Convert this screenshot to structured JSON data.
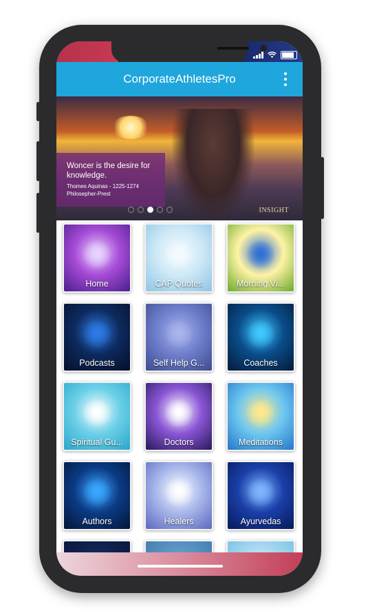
{
  "app": {
    "title": "CorporateAthletesPro"
  },
  "banner": {
    "quote": "Woncer is the desire for knowledge.",
    "author": "Thomes Aquinas - 1225-1274",
    "role": "Philosepher-Prest",
    "logo_text": "INSIGHT",
    "slides_count": 5,
    "active_slide": 2
  },
  "tiles": [
    {
      "label": "Home",
      "icon": "mandala-icon",
      "colors": [
        "#e8d4ff",
        "#a64bd6",
        "#4a1f8c"
      ]
    },
    {
      "label": "CAP Quotes",
      "icon": "flask-quote-icon",
      "colors": [
        "#f4fbff",
        "#cfe9f7",
        "#8ec5e6"
      ]
    },
    {
      "label": "Morning Vi...",
      "icon": "sunrise-field-icon",
      "colors": [
        "#2f6fd6",
        "#fff3a6",
        "#6cab2c"
      ]
    },
    {
      "label": "Podcasts",
      "icon": "microphone-icon",
      "colors": [
        "#2c7be6",
        "#0d2a5e",
        "#050f2a"
      ]
    },
    {
      "label": "Self Help G...",
      "icon": "ladder-lightbulb-icon",
      "colors": [
        "#a8b4ec",
        "#6f7fcc",
        "#3f4b8f"
      ]
    },
    {
      "label": "Coaches",
      "icon": "lightbulb-brain-icon",
      "colors": [
        "#3fc8ff",
        "#0a4d8a",
        "#041a3a"
      ]
    },
    {
      "label": "Spiritual Gu...",
      "icon": "businessman-icon",
      "colors": [
        "#ffffff",
        "#6dd0e8",
        "#2aa7c9"
      ]
    },
    {
      "label": "Doctors",
      "icon": "chakra-icon",
      "colors": [
        "#ffffff",
        "#8a56d6",
        "#2a1a5a"
      ]
    },
    {
      "label": "Meditations",
      "icon": "meditation-icon",
      "colors": [
        "#ffe98a",
        "#6ec7f0",
        "#2577c8"
      ]
    },
    {
      "label": "Authors",
      "icon": "brain-icon",
      "colors": [
        "#3aa8ff",
        "#0b3b86",
        "#041636"
      ]
    },
    {
      "label": "Healers",
      "icon": "healing-hands-icon",
      "colors": [
        "#ffffff",
        "#a9b8ea",
        "#5b69c0"
      ]
    },
    {
      "label": "Ayurvedas",
      "icon": "energy-body-icon",
      "colors": [
        "#7fb5ff",
        "#1a3fa8",
        "#081a5a"
      ]
    },
    {
      "label": "",
      "icon": "partial-tile-icon",
      "colors": [
        "#1e3a78",
        "#102251",
        "#0a1536"
      ]
    },
    {
      "label": "",
      "icon": "partial-tile-icon",
      "colors": [
        "#7fb3d8",
        "#5a94c2",
        "#3d77a8"
      ]
    },
    {
      "label": "",
      "icon": "partial-tile-icon",
      "colors": [
        "#e9f6ff",
        "#a7d8ef",
        "#6fbde0"
      ]
    }
  ],
  "colors": {
    "appbar": "#1fa6dc",
    "quote_box": "#702878",
    "accent": "#c23f57"
  }
}
